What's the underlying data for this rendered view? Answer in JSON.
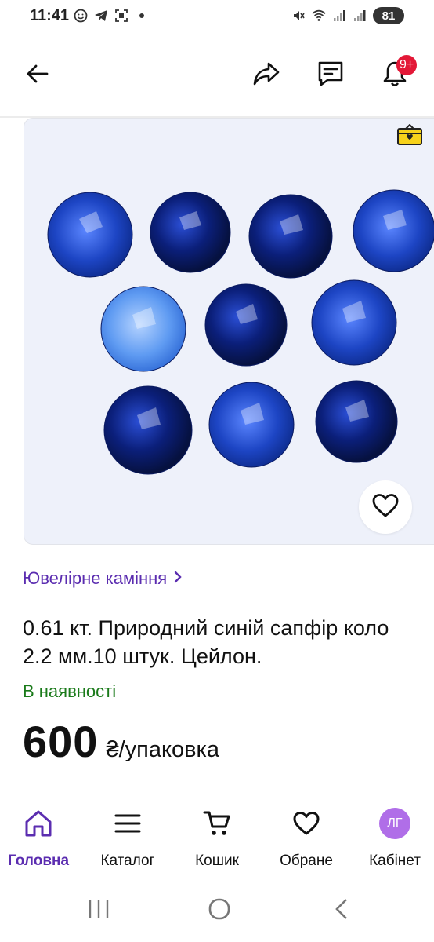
{
  "status_bar": {
    "time": "11:41",
    "battery": "81",
    "icons": [
      "emoji-icon",
      "telegram-icon",
      "screenshot-icon",
      "dot-icon",
      "mute-icon",
      "wifi-icon",
      "signal-icon",
      "signal-icon"
    ]
  },
  "header": {
    "back_icon": "arrow-left-icon",
    "share_icon": "share-icon",
    "chat_icon": "message-icon",
    "notifications_icon": "bell-icon",
    "notifications_badge": "9+"
  },
  "product": {
    "image_alt": "blue sapphire stones",
    "breadcrumb": "Ювелірне каміння",
    "title": "0.61 кт. Природний синій сапфір коло 2.2 мм.10 штук. Цейлон.",
    "availability": "В наявності",
    "price": "600",
    "price_unit": "₴/упаковка"
  },
  "bottom_nav": {
    "items": [
      {
        "label": "Головна",
        "icon": "home-icon",
        "active": true
      },
      {
        "label": "Каталог",
        "icon": "menu-icon",
        "active": false
      },
      {
        "label": "Кошик",
        "icon": "cart-icon",
        "active": false
      },
      {
        "label": "Обране",
        "icon": "heart-icon",
        "active": false
      },
      {
        "label": "Кабінет",
        "icon": "avatar",
        "active": false
      }
    ],
    "avatar_initials": "ЛГ"
  },
  "colors": {
    "accent": "#5b2db0",
    "available": "#1a7a1a",
    "badge": "#e31837",
    "avatar": "#b06ee8"
  }
}
